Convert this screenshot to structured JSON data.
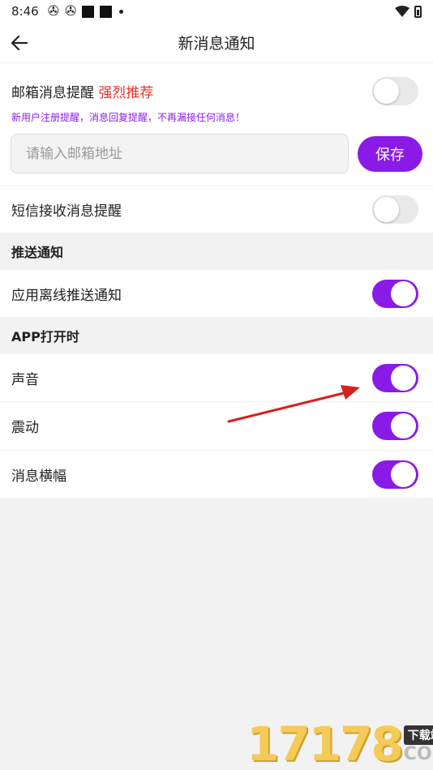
{
  "status_bar": {
    "time": "8:46"
  },
  "header": {
    "title": "新消息通知"
  },
  "email_section": {
    "label": "邮箱消息提醒",
    "recommend": "强烈推荐",
    "hint": "新用户注册提醒，消息回复提醒，不再漏接任何消息！",
    "placeholder": "请输入邮箱地址",
    "value": "",
    "save_label": "保存",
    "enabled": false
  },
  "sms": {
    "label": "短信接收消息提醒",
    "enabled": false
  },
  "push_section": {
    "title": "推送通知",
    "items": [
      {
        "label": "应用离线推送通知",
        "enabled": true
      }
    ]
  },
  "app_open_section": {
    "title": "APP打开时",
    "items": [
      {
        "label": "声音",
        "enabled": true
      },
      {
        "label": "震动",
        "enabled": true
      },
      {
        "label": "消息横幅",
        "enabled": true
      }
    ]
  },
  "watermark": {
    "digits": "17178",
    "tag": "下载站",
    "suffix": "COM"
  },
  "colors": {
    "accent": "#8a1be6",
    "recommend": "#e8302a",
    "hint": "#8a20e8",
    "arrow": "#d6201e"
  }
}
